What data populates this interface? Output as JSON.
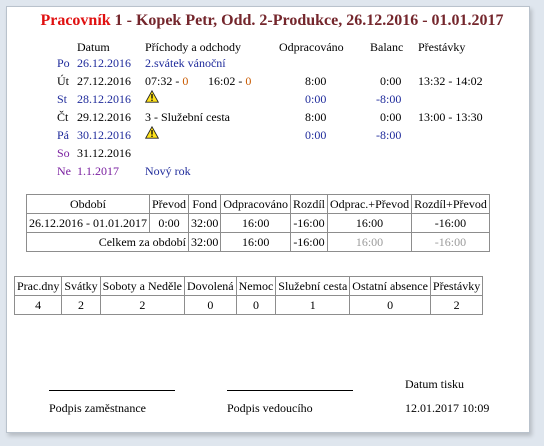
{
  "title": {
    "label": "Pracovník",
    "text": "1 - Kopek Petr, Odd. 2-Produkce, 26.12.2016 - 01.01.2017"
  },
  "headers": {
    "date": "Datum",
    "arrivals": "Příchody a odchody",
    "worked": "Odpracováno",
    "balance": "Balanc",
    "breaks": "Přestávky"
  },
  "days": [
    {
      "dow": "Po",
      "date": "26.12.2016",
      "note": "2.svátek vánoční",
      "color": "blue"
    },
    {
      "dow": "Út",
      "date": "27.12.2016",
      "in": "07:32",
      "in_code": "0",
      "out": "16:02",
      "out_code": "0",
      "worked": "8:00",
      "balance": "0:00",
      "breaks": "13:32 - 14:02",
      "color": "black"
    },
    {
      "dow": "St",
      "date": "28.12.2016",
      "warning": true,
      "worked": "0:00",
      "balance": "-8:00",
      "color": "blue"
    },
    {
      "dow": "Čt",
      "date": "29.12.2016",
      "note": "3 - Služební cesta",
      "worked": "8:00",
      "balance": "0:00",
      "breaks": "13:00 - 13:30",
      "color": "black"
    },
    {
      "dow": "Pá",
      "date": "30.12.2016",
      "warning": true,
      "worked": "0:00",
      "balance": "-8:00",
      "color": "blue"
    },
    {
      "dow": "So",
      "date": "31.12.2016",
      "color": "purple"
    },
    {
      "dow": "Ne",
      "date": "1.1.2017",
      "note": "Nový rok",
      "color": "purple"
    }
  ],
  "period_table": {
    "headers": [
      "Období",
      "Převod",
      "Fond",
      "Odpracováno",
      "Rozdíl",
      "Odprac.+Převod",
      "Rozdíl+Převod"
    ],
    "row": [
      "26.12.2016 - 01.01.2017",
      "0:00",
      "32:00",
      "16:00",
      "-16:00",
      "16:00",
      "-16:00"
    ],
    "total_label": "Celkem za období",
    "total": [
      "32:00",
      "16:00",
      "-16:00",
      "16:00",
      "-16:00"
    ]
  },
  "summary_table": {
    "headers": [
      "Prac.dny",
      "Svátky",
      "Soboty a Neděle",
      "Dovolená",
      "Nemoc",
      "Služební cesta",
      "Ostatní absence",
      "Přestávky"
    ],
    "values": [
      "4",
      "2",
      "2",
      "0",
      "0",
      "1",
      "0",
      "2"
    ]
  },
  "signatures": {
    "employee": "Podpis zaměstnance",
    "manager": "Podpis vedoucího",
    "print_label": "Datum tisku",
    "print_date": "12.01.2017 10:09"
  },
  "colors": {
    "title": "#74262c",
    "label": "#e01010",
    "blue": "#1f2b9b",
    "purple": "#7a1fa0",
    "code": "#c85a00"
  }
}
